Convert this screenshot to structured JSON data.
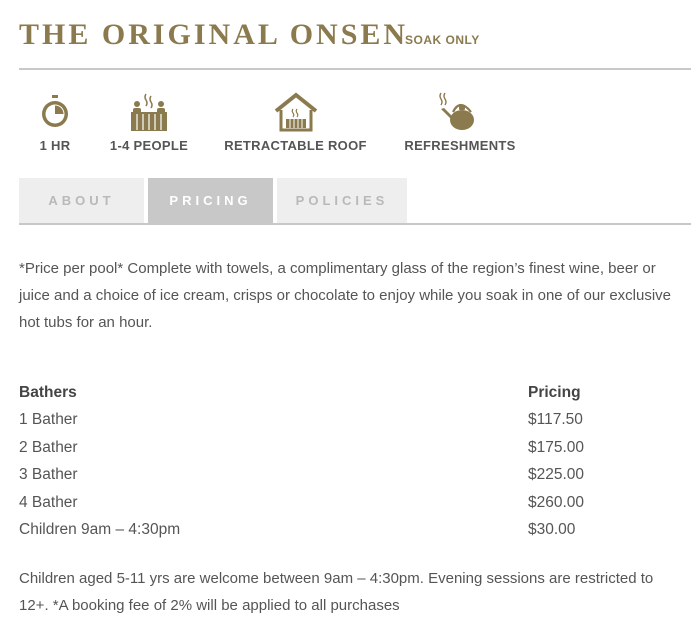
{
  "header": {
    "title": "THE ORIGINAL ONSEN",
    "subtitle": "SOAK ONLY"
  },
  "features": [
    {
      "icon": "stopwatch-icon",
      "label": "1 HR"
    },
    {
      "icon": "hot-tub-people-icon",
      "label": "1-4 PEOPLE"
    },
    {
      "icon": "house-tub-icon",
      "label": "RETRACTABLE ROOF"
    },
    {
      "icon": "teapot-icon",
      "label": "REFRESHMENTS"
    }
  ],
  "tabs": [
    {
      "label": "ABOUT",
      "active": false
    },
    {
      "label": "PRICING",
      "active": true
    },
    {
      "label": "POLICIES",
      "active": false
    }
  ],
  "intro": "*Price per pool* Complete with towels, a complimentary glass of the region’s finest wine, beer or juice and a choice of ice cream, crisps or chocolate to enjoy while you soak in one of our exclusive hot tubs for an hour.",
  "pricing": {
    "headers": [
      "Bathers",
      "Pricing"
    ],
    "rows": [
      [
        "1 Bather",
        "$117.50"
      ],
      [
        "2 Bather",
        "$175.00"
      ],
      [
        "3 Bather",
        "$225.00"
      ],
      [
        "4 Bather",
        "$260.00"
      ],
      [
        "Children 9am – 4:30pm",
        "$30.00"
      ]
    ]
  },
  "footer_note": "Children aged 5-11 yrs are welcome between 9am – 4:30pm. Evening sessions are restricted to 12+. *A booking fee of 2% will be applied to all purchases",
  "colors": {
    "brand_gold": "#8b7a4e",
    "tab_active_bg": "#c8c8c8",
    "tab_inactive_bg": "#eeeeee",
    "text": "#555555"
  }
}
